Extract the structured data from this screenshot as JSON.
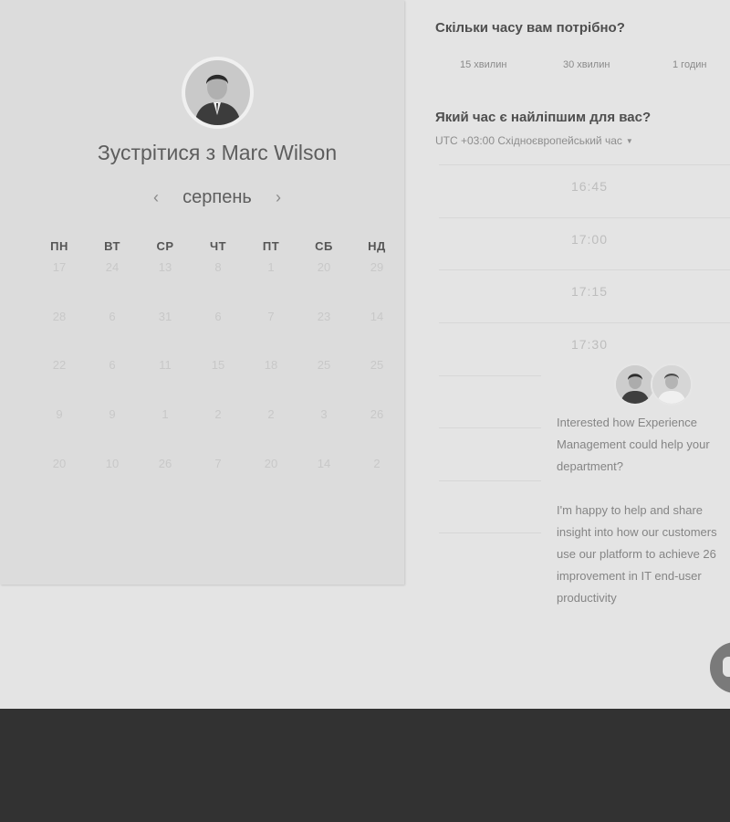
{
  "calendar": {
    "title_prefix": "Зустрітися з",
    "host_name": "Marc Wilson",
    "month": "серпень",
    "prev_icon": "‹",
    "next_icon": "›",
    "weekdays": [
      "ПН",
      "ВТ",
      "СР",
      "ЧТ",
      "ПТ",
      "СБ",
      "НД"
    ],
    "weeks": [
      [
        "17",
        "24",
        "13",
        "8",
        "1",
        "20",
        "29"
      ],
      [
        "28",
        "6",
        "31",
        "6",
        "7",
        "23",
        "14"
      ],
      [
        "22",
        "6",
        "11",
        "15",
        "18",
        "25",
        "25"
      ],
      [
        "9",
        "9",
        "1",
        "2",
        "2",
        "3",
        "26"
      ],
      [
        "20",
        "10",
        "26",
        "7",
        "20",
        "14",
        "2"
      ]
    ]
  },
  "scheduler": {
    "duration_question": "Скільки часу вам потрібно?",
    "durations": [
      "15 хвилин",
      "30 хвилин",
      "1 годин"
    ],
    "time_question": "Який час є найліпшим для вас?",
    "timezone": "UTC +03:00 Східноєвропейський час",
    "slots": [
      "16:45",
      "17:00",
      "17:15",
      "17:30",
      "",
      "",
      "",
      ""
    ]
  },
  "chat": {
    "message_1": "Interested how Experience Management could help your department?",
    "message_2": "I'm happy to help and share insight into how our customers use our platform to achieve 26 improvement in IT end-user productivity"
  },
  "colors": {
    "page_bg": "#e4e4e4",
    "panel_bg": "#dcdcdc",
    "footer_bg": "#323232"
  }
}
